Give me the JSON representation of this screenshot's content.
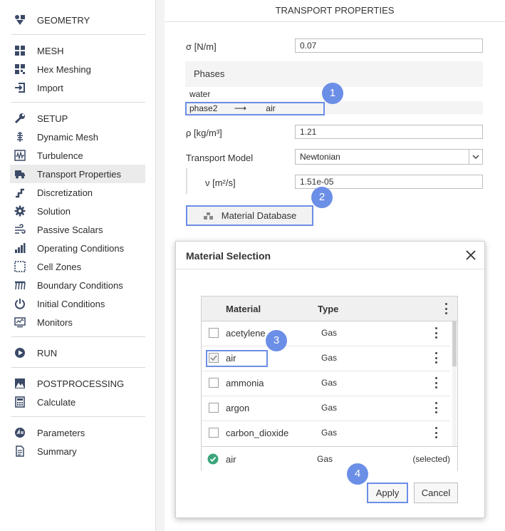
{
  "sidebar": {
    "geometry": {
      "label": "GEOMETRY",
      "icon": "geometry-icon"
    },
    "mesh": {
      "label": "MESH",
      "icon": "grid-icon"
    },
    "hex_meshing": {
      "label": "Hex Meshing",
      "icon": "hex-mesh-icon"
    },
    "import": {
      "label": "Import",
      "icon": "import-icon"
    },
    "setup": {
      "label": "SETUP",
      "icon": "wrench-icon"
    },
    "dynamic_mesh": {
      "label": "Dynamic Mesh",
      "icon": "dynamic-mesh-icon"
    },
    "turbulence": {
      "label": "Turbulence",
      "icon": "turbulence-icon"
    },
    "transport_properties": {
      "label": "Transport Properties",
      "icon": "truck-icon"
    },
    "discretization": {
      "label": "Discretization",
      "icon": "discretization-icon"
    },
    "solution": {
      "label": "Solution",
      "icon": "gear-icon"
    },
    "passive_scalars": {
      "label": "Passive Scalars",
      "icon": "wind-icon"
    },
    "operating_conditions": {
      "label": "Operating Conditions",
      "icon": "bars-icon"
    },
    "cell_zones": {
      "label": "Cell Zones",
      "icon": "cell-zones-icon"
    },
    "boundary_conditions": {
      "label": "Boundary Conditions",
      "icon": "boundary-icon"
    },
    "initial_conditions": {
      "label": "Initial Conditions",
      "icon": "power-icon"
    },
    "monitors": {
      "label": "Monitors",
      "icon": "monitor-icon"
    },
    "run": {
      "label": "RUN",
      "icon": "play-icon"
    },
    "postprocessing": {
      "label": "POSTPROCESSING",
      "icon": "image-icon"
    },
    "calculate": {
      "label": "Calculate",
      "icon": "calculator-icon"
    },
    "parameters": {
      "label": "Parameters",
      "icon": "parameters-icon"
    },
    "summary": {
      "label": "Summary",
      "icon": "document-icon"
    }
  },
  "panel": {
    "title": "TRANSPORT PROPERTIES",
    "sigma_label": "σ [N/m]",
    "sigma_value": "0.07",
    "phases_header": "Phases",
    "phase_water": "water",
    "phase2_name": "phase2",
    "phase2_arrow": "⟶",
    "phase2_material": "air",
    "rho_label": "ρ [kg/m³]",
    "rho_value": "1.21",
    "transport_model_label": "Transport Model",
    "transport_model_value": "Newtonian",
    "nu_label": "ν [m²/s]",
    "nu_value": "1.51e-05",
    "material_db_label": "Material Database"
  },
  "badges": {
    "b1": "1",
    "b2": "2",
    "b3": "3",
    "b4": "4"
  },
  "dialog": {
    "title": "Material Selection",
    "col_material": "Material",
    "col_type": "Type",
    "rows": [
      {
        "name": "acetylene",
        "type": "Gas",
        "checked": false
      },
      {
        "name": "air",
        "type": "Gas",
        "checked": true
      },
      {
        "name": "ammonia",
        "type": "Gas",
        "checked": false
      },
      {
        "name": "argon",
        "type": "Gas",
        "checked": false
      },
      {
        "name": "carbon_dioxide",
        "type": "Gas",
        "checked": false
      }
    ],
    "selected_name": "air",
    "selected_type": "Gas",
    "selected_status": "(selected)",
    "apply_label": "Apply",
    "cancel_label": "Cancel"
  },
  "colors": {
    "accent": "#6b8ee6",
    "check_green": "#3aa57a",
    "icon": "#3b4a66"
  }
}
